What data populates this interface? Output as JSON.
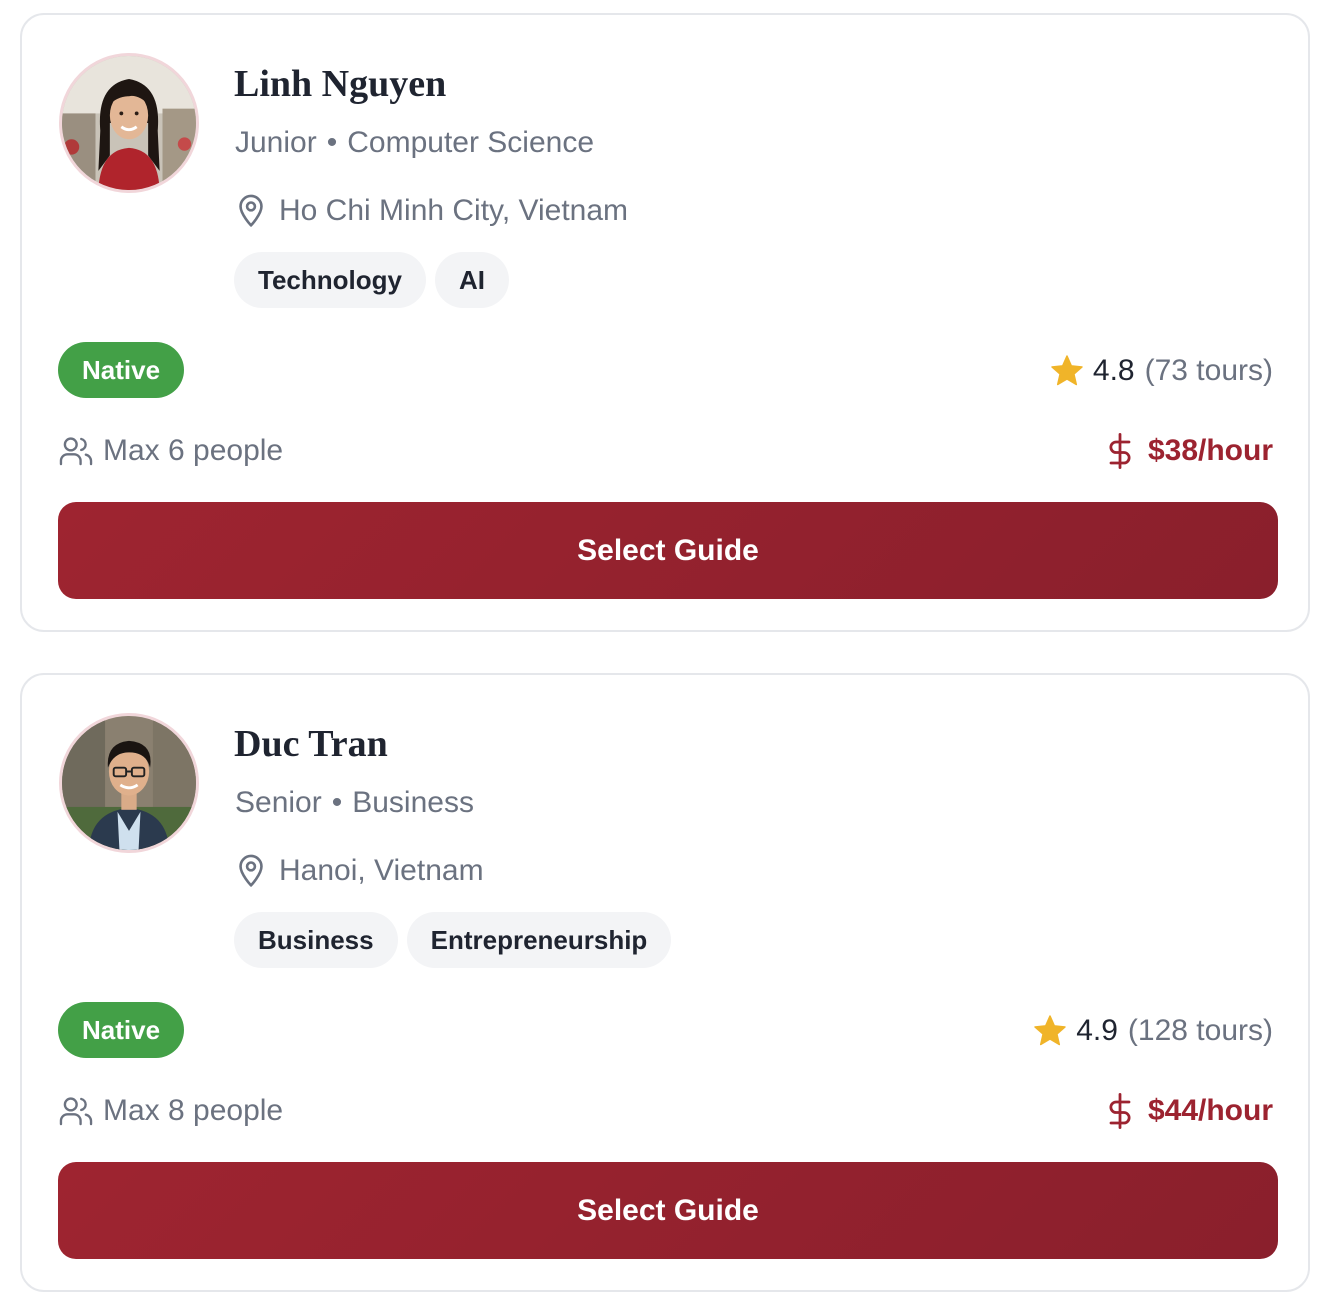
{
  "guides": [
    {
      "name": "Linh Nguyen",
      "year": "Junior",
      "separator": "•",
      "major": "Computer Science",
      "location": "Ho Chi Minh City, Vietnam",
      "tags": [
        "Technology",
        "AI"
      ],
      "badge": "Native",
      "rating": "4.8",
      "tours": "(73 tours)",
      "capacity": "Max 6 people",
      "price": "$38/hour",
      "button_label": "Select Guide",
      "avatar_icon": "avatar-photo-woman"
    },
    {
      "name": "Duc Tran",
      "year": "Senior",
      "separator": "•",
      "major": "Business",
      "location": "Hanoi, Vietnam",
      "tags": [
        "Business",
        "Entrepreneurship"
      ],
      "badge": "Native",
      "rating": "4.9",
      "tours": "(128 tours)",
      "capacity": "Max 8 people",
      "price": "$44/hour",
      "button_label": "Select Guide",
      "avatar_icon": "avatar-photo-man"
    }
  ],
  "icons": {
    "location": "map-pin-icon",
    "rating": "star-icon",
    "capacity": "users-icon",
    "price": "dollar-icon"
  },
  "colors": {
    "accent": "#9c2330",
    "button_start": "#9e2430",
    "button_end": "#8a1f2c",
    "native_badge": "#43a047",
    "star": "#f0b429",
    "muted_text": "#6b7280",
    "tag_bg": "#f3f4f6",
    "card_border": "#e5e7eb"
  }
}
